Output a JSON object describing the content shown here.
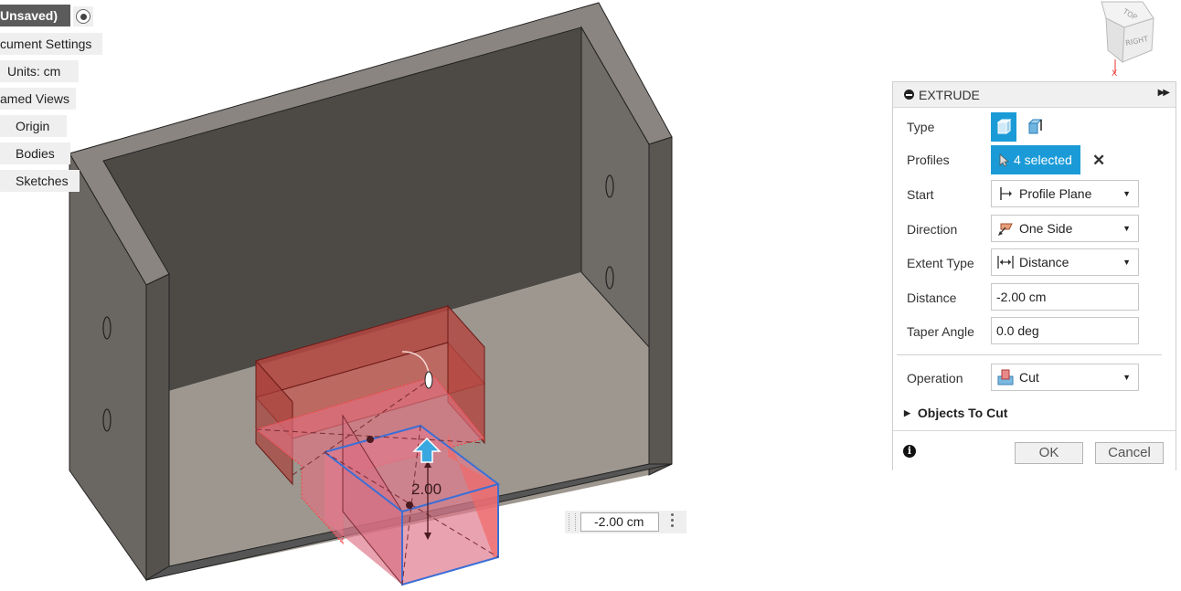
{
  "browser": {
    "title": "Unsaved)",
    "items": [
      {
        "label": "cument Settings"
      },
      {
        "label": "Units: cm"
      },
      {
        "label": "amed Views"
      },
      {
        "label": "Origin"
      },
      {
        "label": "Bodies"
      },
      {
        "label": "Sketches"
      }
    ]
  },
  "viewcube": {
    "top": "TOP",
    "right": "RIGHT",
    "axis": "X"
  },
  "viewport": {
    "dimension_label": "2.00"
  },
  "dialog": {
    "title": "EXTRUDE",
    "type_label": "Type",
    "profiles_label": "Profiles",
    "profiles_value": "4 selected",
    "start_label": "Start",
    "start_value": "Profile Plane",
    "direction_label": "Direction",
    "direction_value": "One Side",
    "extent_label": "Extent Type",
    "extent_value": "Distance",
    "distance_label": "Distance",
    "distance_value": "-2.00 cm",
    "taper_label": "Taper Angle",
    "taper_value": "0.0 deg",
    "operation_label": "Operation",
    "operation_value": "Cut",
    "objects_to_cut": "Objects To Cut",
    "ok": "OK",
    "cancel": "Cancel"
  },
  "floating_input": {
    "value": "-2.00 cm"
  },
  "colors": {
    "accent": "#1a9bd7",
    "cut_red": "#d9534f",
    "body_gray": "#6f6b66"
  }
}
